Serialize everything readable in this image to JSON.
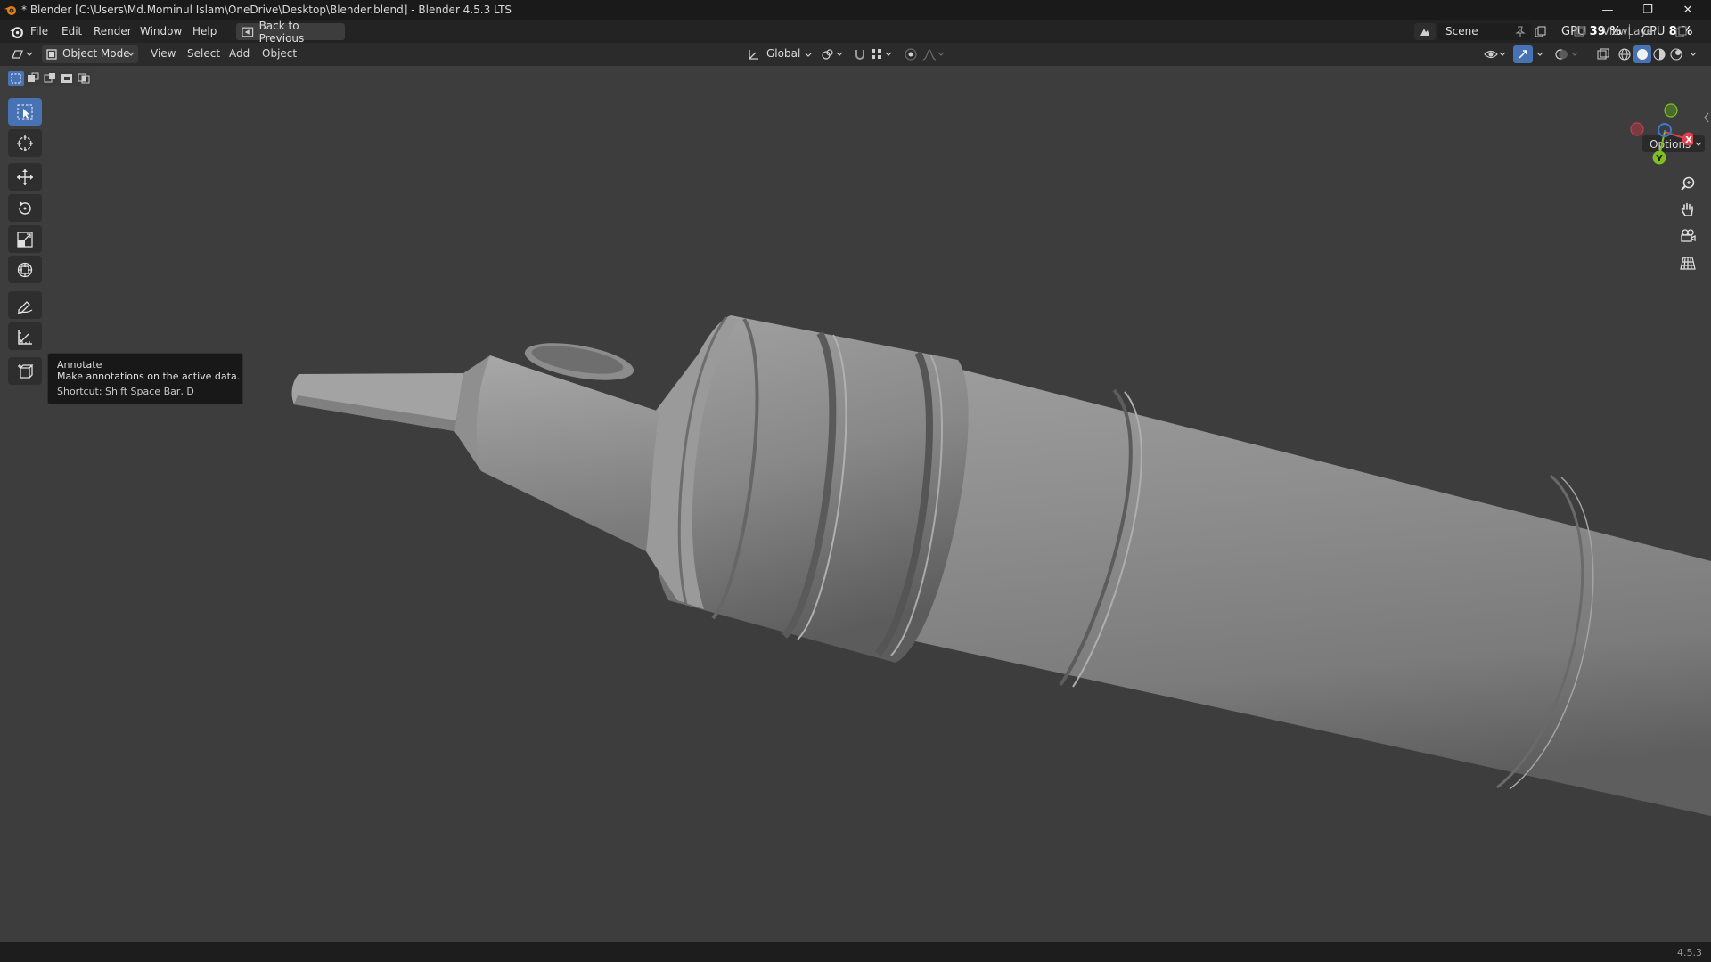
{
  "window": {
    "title": "* Blender [C:\\Users\\Md.Mominul Islam\\OneDrive\\Desktop\\Blender.blend] - Blender 4.5.3 LTS"
  },
  "menubar": {
    "items": [
      "File",
      "Edit",
      "Render",
      "Window",
      "Help"
    ],
    "back_button": "Back to Previous",
    "scene_label": "Scene",
    "view_layer_label": "ViewLayer",
    "gpu_label": "GPU",
    "gpu_value": "39 %",
    "cpu_label": "CPU",
    "cpu_value": "8 %"
  },
  "header": {
    "mode": "Object Mode",
    "menus": [
      "View",
      "Select",
      "Add",
      "Object"
    ],
    "transform_orientation": "Global",
    "options_label": "Options"
  },
  "tooltip": {
    "title": "Annotate",
    "description": "Make annotations on the active data.",
    "shortcut": "Shortcut: Shift Space Bar, D"
  },
  "gizmo": {
    "x_label": "X",
    "y_label": "Y",
    "x_color": "#e0404a",
    "y_color": "#7fbf1f",
    "z_color": "#3c78d8"
  },
  "toolbar": {
    "active_tool": "select-box",
    "tools": [
      "select-box",
      "cursor",
      "move",
      "rotate",
      "scale",
      "transform",
      "annotate",
      "measure",
      "add-cube"
    ]
  },
  "statusbar": {
    "version": "4.5.3"
  },
  "colors": {
    "accent": "#4772b3",
    "viewport_bg": "#3d3d3d"
  }
}
